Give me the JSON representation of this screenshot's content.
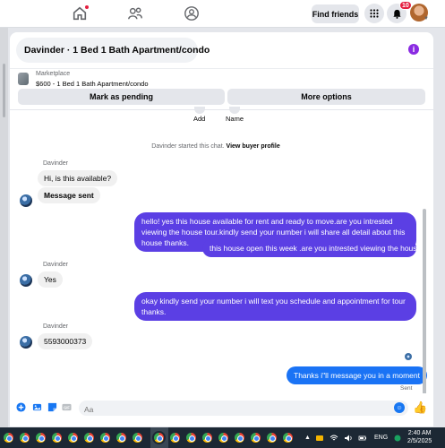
{
  "topbar": {
    "find_friends": "Find friends",
    "notification_count": "10",
    "icons": [
      "home-icon",
      "people-icon",
      "groups-icon",
      "menu-grid-icon",
      "bell-icon"
    ]
  },
  "chat": {
    "title": "Davinder · 1 Bed 1 Bath Apartment/condo",
    "marketplace_label": "Marketplace",
    "listing_detail": "$600 - 1 Bed 1 Bath Apartment/condo",
    "mark_pending": "Mark as pending",
    "more_options": "More options",
    "add_label": "Add",
    "name_label": "Name",
    "system_text": "Davinder started this chat.",
    "view_profile": "View buyer profile",
    "messages": [
      {
        "sender": "Davinder",
        "text": "Hi, is this available?"
      },
      {
        "text": "Message sent"
      },
      {
        "text": "hello! yes this house available for rent and ready to move.are you intrested viewing the house tour.kindly send your number i will share all detail about this house thanks."
      },
      {
        "text": "this house open this week .are you intrested viewing the house?"
      },
      {
        "sender": "Davinder",
        "text": "Yes"
      },
      {
        "text": "okay kindly send your number i will text you schedule and appointment for tour thanks."
      },
      {
        "sender": "Davinder",
        "text": "5593000373"
      },
      {
        "text": "Thanks i\"ll message you in a moment"
      }
    ],
    "sent_status": "Sent",
    "composer_placeholder": "Aa"
  },
  "taskbar": {
    "language": "ENG",
    "time": "2:40 AM",
    "date": "2/5/2025"
  },
  "colors": {
    "outgoing": "#5b3fe4",
    "outgoing_last": "#1a73f5",
    "incoming": "#f0f0f0",
    "accent": "#1877f2"
  }
}
